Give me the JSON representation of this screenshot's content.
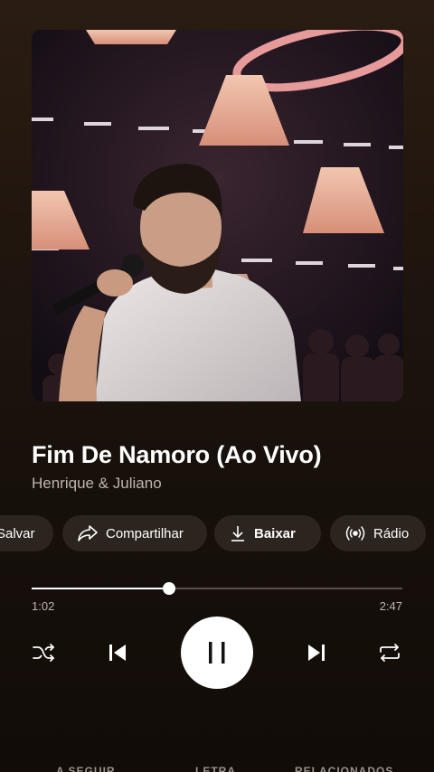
{
  "track": {
    "title": "Fim De Namoro (Ao Vivo)",
    "artist": "Henrique & Juliano"
  },
  "actions": [
    {
      "label": "Salvar",
      "icon": "save-icon",
      "bold": false
    },
    {
      "label": "Compartilhar",
      "icon": "share-icon",
      "bold": false
    },
    {
      "label": "Baixar",
      "icon": "download-icon",
      "bold": true
    },
    {
      "label": "Rádio",
      "icon": "radio-icon",
      "bold": false
    }
  ],
  "player": {
    "elapsed": "1:02",
    "duration": "2:47",
    "progress": 0.371,
    "state": "playing"
  },
  "bottom_tabs": [
    "A SEGUIR",
    "LETRA",
    "RELACIONADOS"
  ],
  "colors": {
    "background": "#1f150e",
    "chip": "#2c241e",
    "accent": "#ffffff",
    "secondary_text": "#bdb5ae"
  }
}
